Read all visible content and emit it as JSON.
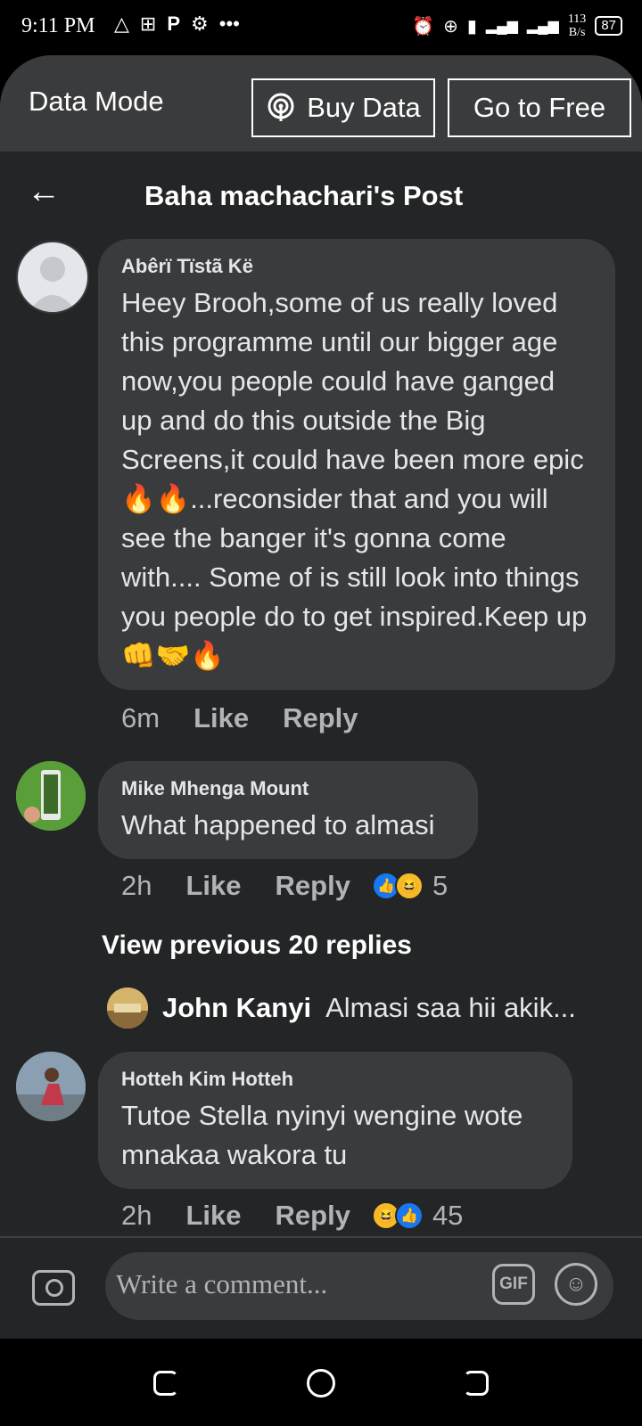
{
  "status_bar": {
    "time": "9:11 PM",
    "left_icons": [
      "warning-triangle-icon",
      "battery-saver-icon",
      "p-icon",
      "settings-gear-icon",
      "more-dots-icon"
    ],
    "speed": "113",
    "speed_unit": "B/s",
    "battery": "87"
  },
  "data_bar": {
    "mode_label": "Data Mode",
    "buy_button": "Buy Data",
    "free_button": "Go to Free"
  },
  "header": {
    "title": "Baha machachari's Post"
  },
  "comments": [
    {
      "author": "Abêrï Tïstã Kë",
      "text": "Heey Brooh,some of us really loved this programme until our bigger age now,you people could have ganged up and do this outside the Big Screens,it could have been more epic 🔥🔥...reconsider that and you will see the banger it's gonna come with.... Some of is still look into things you people do to get inspired.Keep up👊🤝🔥",
      "time": "6m",
      "like": "Like",
      "reply": "Reply"
    },
    {
      "author": "Mike Mhenga Mount",
      "text": "What happened to almasi",
      "time": "2h",
      "like": "Like",
      "reply": "Reply",
      "reaction_count": "5",
      "view_previous": "View previous 20 replies",
      "reply_preview": {
        "author": "John Kanyi",
        "text": "Almasi saa hii akik..."
      }
    },
    {
      "author": "Hotteh Kim Hotteh",
      "text": "Tutoe Stella nyinyi wengine wote mnakaa wakora tu",
      "time": "2h",
      "like": "Like",
      "reply": "Reply",
      "reaction_count": "45"
    }
  ],
  "comment_bar": {
    "placeholder": "Write a comment...",
    "gif": "GIF"
  },
  "colors": {
    "background": "#242526",
    "bubble": "#3a3b3c",
    "text": "#e4e6eb",
    "muted": "#b0b3b8",
    "like_blue": "#1877f2"
  }
}
